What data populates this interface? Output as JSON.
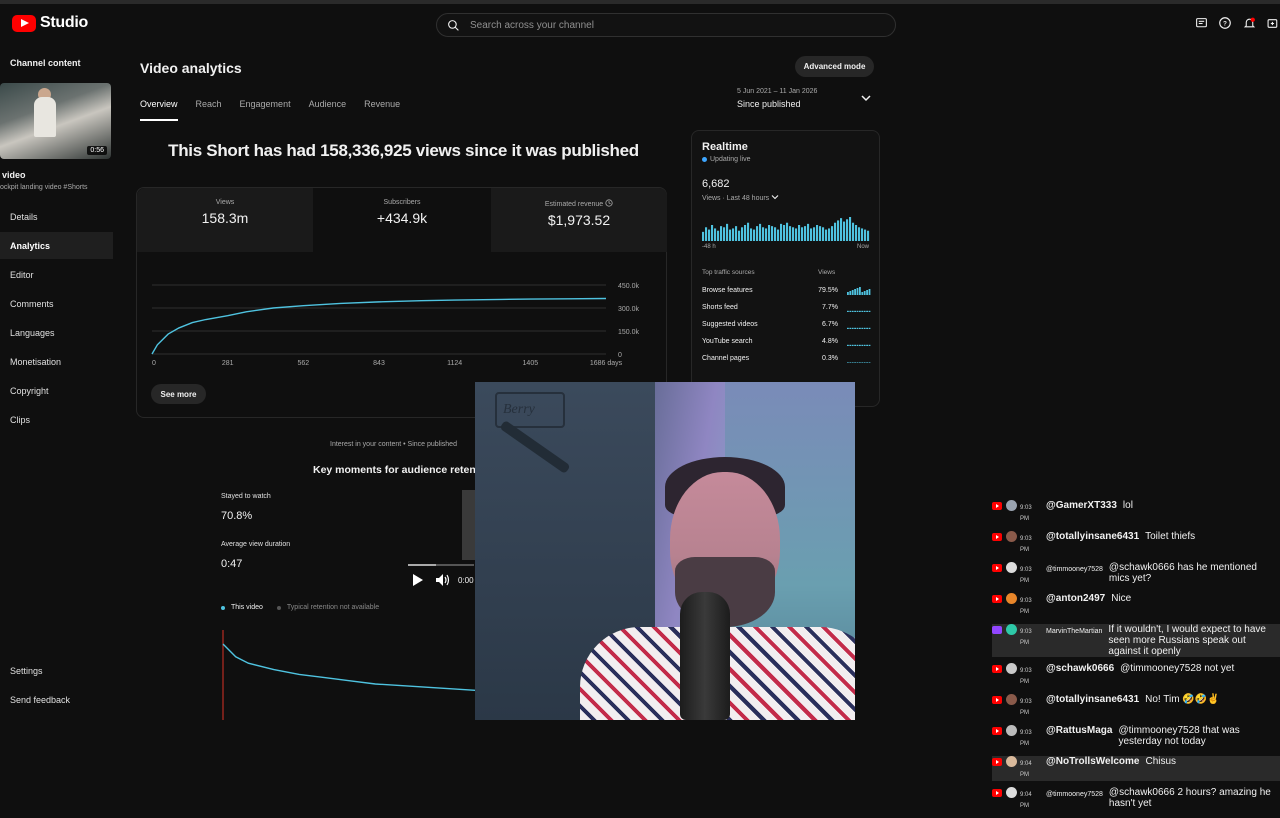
{
  "app": {
    "name": "Studio"
  },
  "search": {
    "placeholder": "Search across your channel"
  },
  "header_icons": [
    "feedback-icon",
    "help-icon",
    "notifications-icon",
    "create-icon"
  ],
  "sidebar": {
    "title": "Channel content",
    "thumbnail_duration": "0:56",
    "video_title": "video",
    "video_subtitle": "ockpit landing video #Shorts",
    "items": [
      {
        "label": "Details"
      },
      {
        "label": "Analytics"
      },
      {
        "label": "Editor"
      },
      {
        "label": "Comments"
      },
      {
        "label": "Languages"
      },
      {
        "label": "Monetisation"
      },
      {
        "label": "Copyright"
      },
      {
        "label": "Clips"
      }
    ],
    "bottom_items": [
      {
        "label": "Settings"
      },
      {
        "label": "Send feedback"
      }
    ]
  },
  "main": {
    "title": "Video analytics",
    "advanced_mode": "Advanced mode",
    "tabs": [
      "Overview",
      "Reach",
      "Engagement",
      "Audience",
      "Revenue"
    ],
    "active_tab": "Overview",
    "date_range": "5 Jun 2021 – 11 Jan 2026",
    "date_preset": "Since published",
    "headline": "This Short has had 158,336,925 views since it was published",
    "metrics": [
      {
        "label": "Views",
        "value": "158.3m"
      },
      {
        "label": "Subscribers",
        "value": "+434.9k"
      },
      {
        "label": "Estimated revenue",
        "value": "$1,973.52"
      }
    ],
    "see_more": "See more",
    "interest_caption": "Interest in your content • Since published",
    "key_moments_title": "Key moments for audience retent",
    "stayed_to_watch_label": "Stayed to watch",
    "stayed_to_watch_value": "70.8%",
    "avg_view_duration_label": "Average view duration",
    "avg_view_duration_value": "0:47",
    "legend_this_video": "This video",
    "legend_typical": "Typical retention not available",
    "player_time": "0:00"
  },
  "chart_data": [
    {
      "type": "line",
      "title": "",
      "xlabel": "",
      "ylabel": "",
      "x_ticks": [
        "0",
        "281",
        "562",
        "843",
        "1124",
        "1405",
        "1686 days"
      ],
      "y_ticks": [
        "0",
        "150.0k",
        "300.0k",
        "450.0k"
      ],
      "xlim": [
        0,
        1686
      ],
      "ylim": [
        0,
        450000
      ],
      "series": [
        {
          "x": [
            0,
            20,
            60,
            100,
            150,
            200,
            281,
            350,
            450,
            562,
            700,
            843,
            1000,
            1124,
            1300,
            1405,
            1550,
            1686
          ],
          "y": [
            0,
            60000,
            130000,
            170000,
            205000,
            225000,
            250000,
            275000,
            300000,
            315000,
            330000,
            340000,
            348000,
            352000,
            356000,
            358000,
            360000,
            362000
          ]
        }
      ],
      "grid": true,
      "color": "#4fc3e0"
    },
    {
      "type": "bar",
      "title": "Realtime",
      "x_ticks": [
        "-48 h",
        "Now"
      ],
      "values": [
        8,
        12,
        10,
        14,
        11,
        9,
        13,
        12,
        15,
        10,
        11,
        13,
        9,
        12,
        14,
        16,
        11,
        10,
        13,
        15,
        12,
        11,
        14,
        13,
        12,
        10,
        15,
        14,
        16,
        13,
        12,
        11,
        14,
        12,
        13,
        15,
        11,
        12,
        14,
        13,
        12,
        10,
        11,
        13,
        16,
        18,
        20,
        17,
        19,
        21,
        16,
        14,
        12,
        11,
        10,
        9
      ],
      "color": "#4fc3e0"
    },
    {
      "type": "line",
      "title": "",
      "xlabel": "",
      "ylabel": "",
      "series": [
        {
          "name": "This video",
          "x": [
            0,
            0.05,
            0.1,
            0.2,
            0.3,
            0.4,
            0.5,
            0.6,
            0.7,
            0.8,
            0.9,
            1.0
          ],
          "y": [
            100,
            92,
            88,
            84,
            81,
            79,
            77,
            75,
            74,
            73,
            72,
            71
          ]
        }
      ],
      "color": "#4fc3e0"
    }
  ],
  "realtime": {
    "title": "Realtime",
    "live_label": "Updating live",
    "count": "6,682",
    "range_label": "Views · Last 48 hours",
    "axis_start": "-48 h",
    "axis_end": "Now",
    "table_header_source": "Top traffic sources",
    "table_header_views": "Views",
    "sources": [
      {
        "name": "Browse features",
        "pct": "79.5%"
      },
      {
        "name": "Shorts feed",
        "pct": "7.7%"
      },
      {
        "name": "Suggested videos",
        "pct": "6.7%"
      },
      {
        "name": "YouTube search",
        "pct": "4.8%"
      },
      {
        "name": "Channel pages",
        "pct": "0.3%"
      }
    ]
  },
  "webcam": {
    "sign_text": "Berry"
  },
  "chat": [
    {
      "platform": "yt",
      "time": "9:03 PM",
      "user": "@GamerXT333",
      "msg": "lol",
      "avatar": "#9aa3b0"
    },
    {
      "platform": "yt",
      "time": "9:03 PM",
      "user": "@totallyinsane6431",
      "msg": "Toilet thiefs",
      "avatar": "#8a5a4a"
    },
    {
      "platform": "yt",
      "time": "9:03 PM",
      "user": "@timmooney7528",
      "msg": "@schawk0666 has he mentioned mics yet?",
      "avatar": "#dcdcdc",
      "small": true
    },
    {
      "platform": "yt",
      "time": "9:03 PM",
      "user": "@anton2497",
      "msg": "Nice",
      "avatar": "#e8862a"
    },
    {
      "platform": "tw",
      "time": "9:03 PM",
      "user": "MarvinTheMartian",
      "msg": "If it wouldn't, I would expect to have seen more Russians speak out against it openly",
      "avatar": "#2ec9a8",
      "small": true,
      "hl": true
    },
    {
      "platform": "yt",
      "time": "9:03 PM",
      "user": "@schawk0666",
      "msg": "@timmooney7528 not yet",
      "avatar": "#c9c9c9"
    },
    {
      "platform": "yt",
      "time": "9:03 PM",
      "user": "@totallyinsane6431",
      "msg": "No! Tim 🤣🤣✌",
      "avatar": "#8a5a4a"
    },
    {
      "platform": "yt",
      "time": "9:03 PM",
      "user": "@RattusMaga",
      "msg": "@timmooney7528 that was yesterday not today",
      "avatar": "#bbbbbb"
    },
    {
      "platform": "yt",
      "time": "9:04 PM",
      "user": "@NoTrollsWelcome",
      "msg": "Chisus",
      "avatar": "#d9b99b",
      "hl": true
    },
    {
      "platform": "yt",
      "time": "9:04 PM",
      "user": "@timmooney7528",
      "msg": "@schawk0666 2 hours? amazing he hasn't yet",
      "avatar": "#dcdcdc",
      "small": true
    }
  ]
}
